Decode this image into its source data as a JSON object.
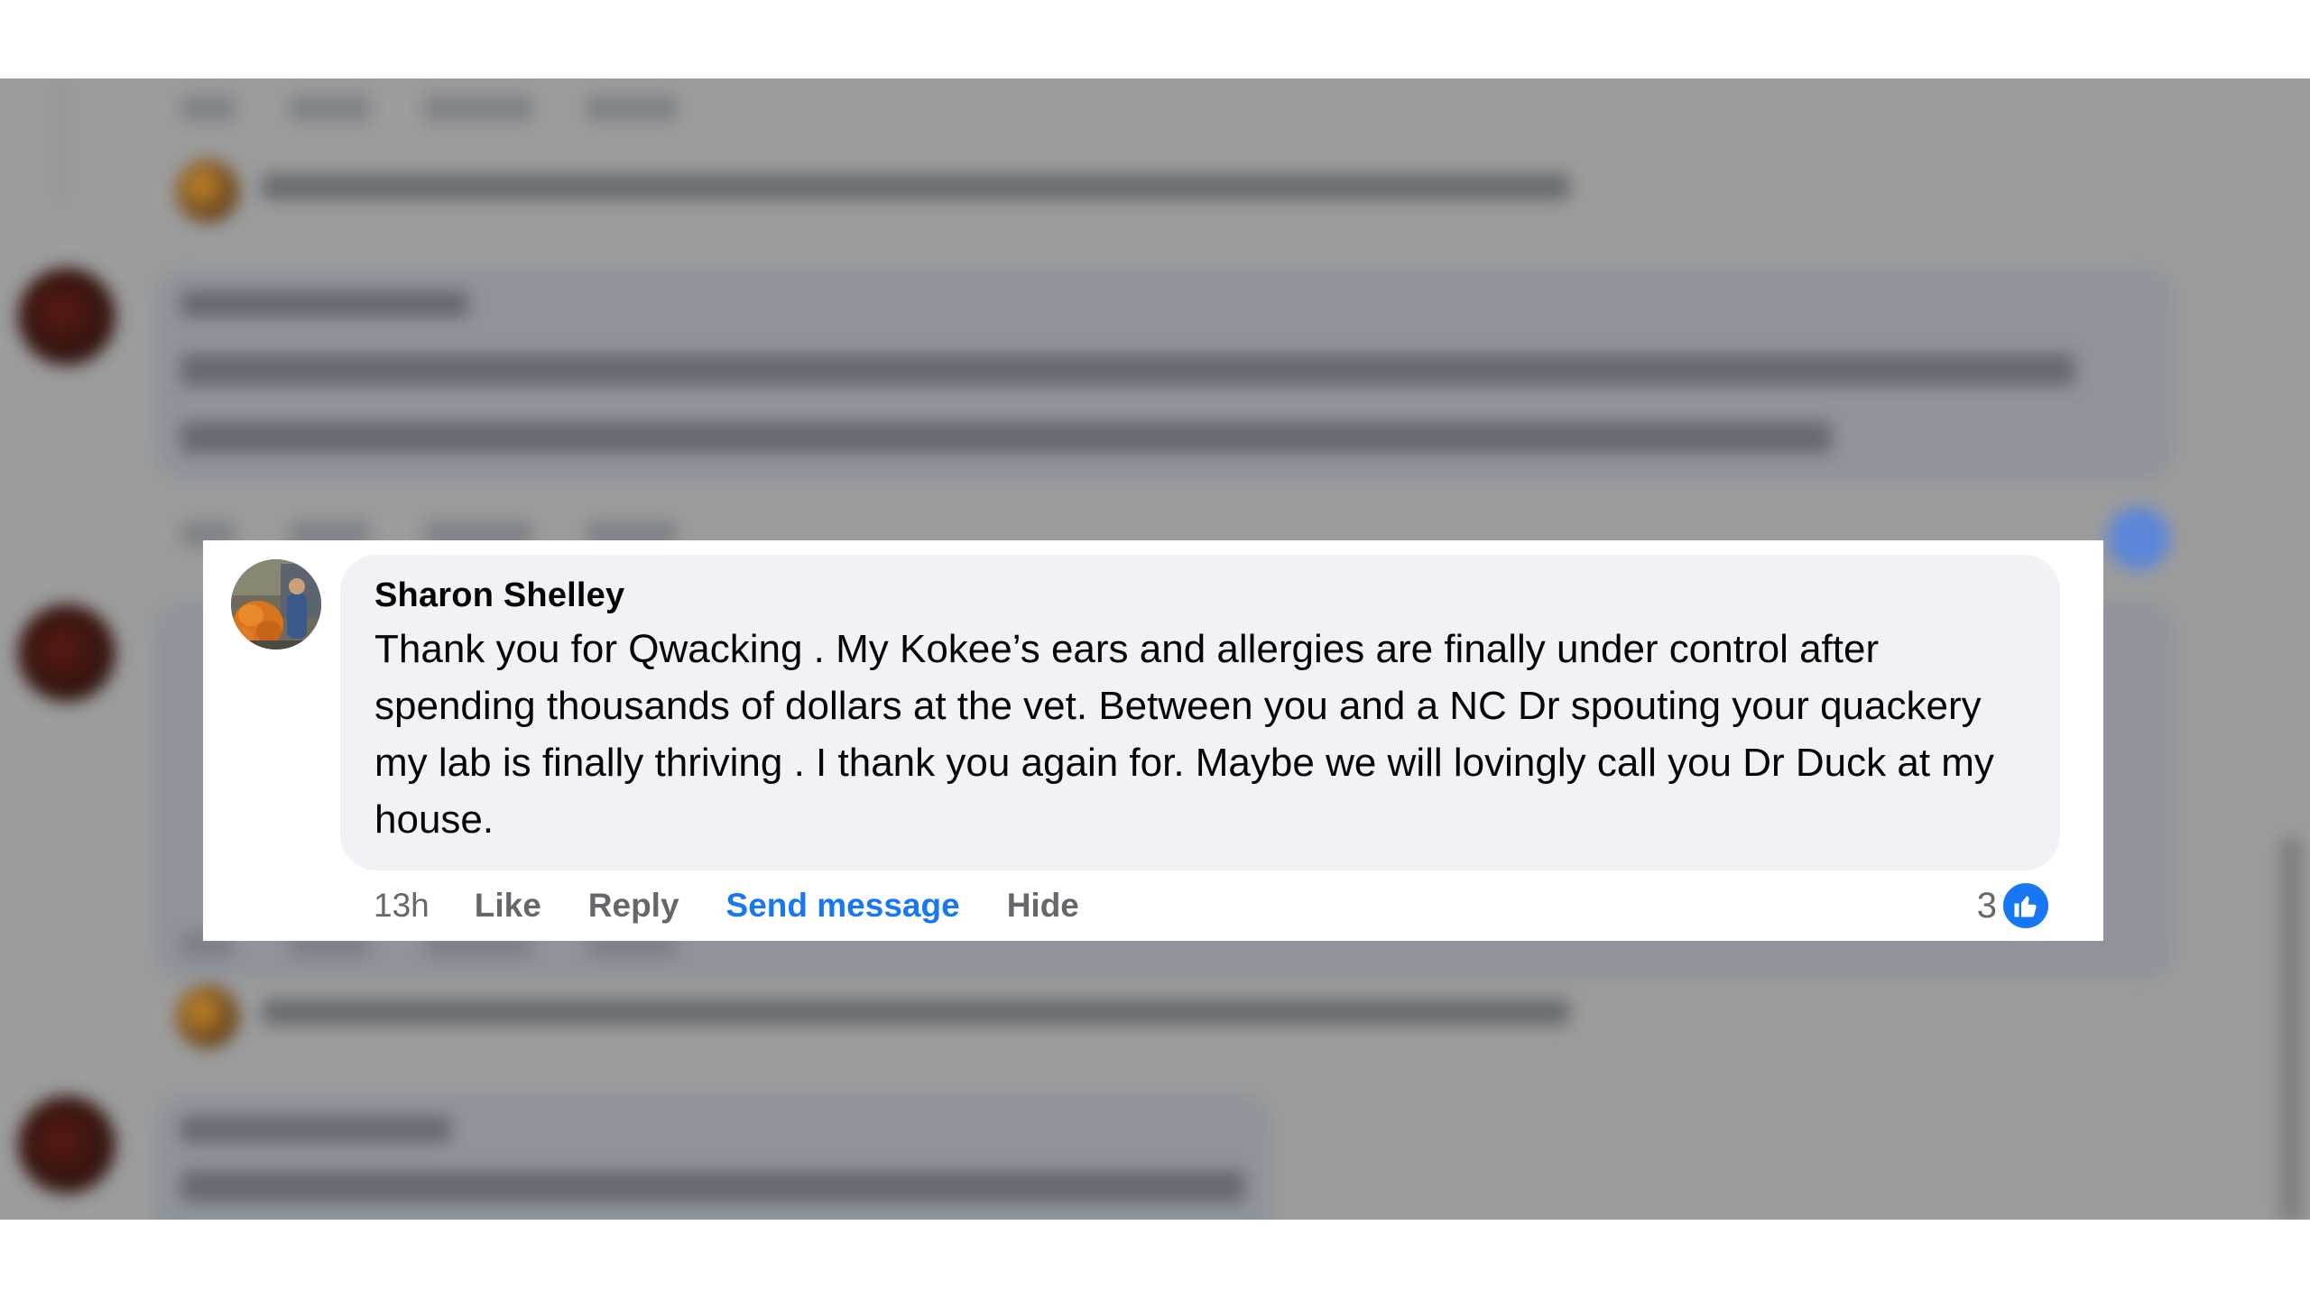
{
  "comment": {
    "author": "Sharon Shelley",
    "text": "Thank you for Qwacking . My Kokee’s ears and allergies are finally under control after spending thousands of dollars at the vet. Between you and a NC Dr spouting your quackery my lab is finally thriving . I thank you again for. Maybe we will lovingly call you Dr Duck at my house.",
    "time": "13h",
    "actions": {
      "like": "Like",
      "reply": "Reply",
      "send_message": "Send message",
      "hide": "Hide"
    },
    "reaction_count": "3",
    "reaction_icon": "thumbs-up-icon"
  },
  "colors": {
    "link_blue": "#1877f2",
    "bubble": "#f0f2f5",
    "muted_text": "#65676b",
    "background_overlay": "#9c9c9c"
  }
}
